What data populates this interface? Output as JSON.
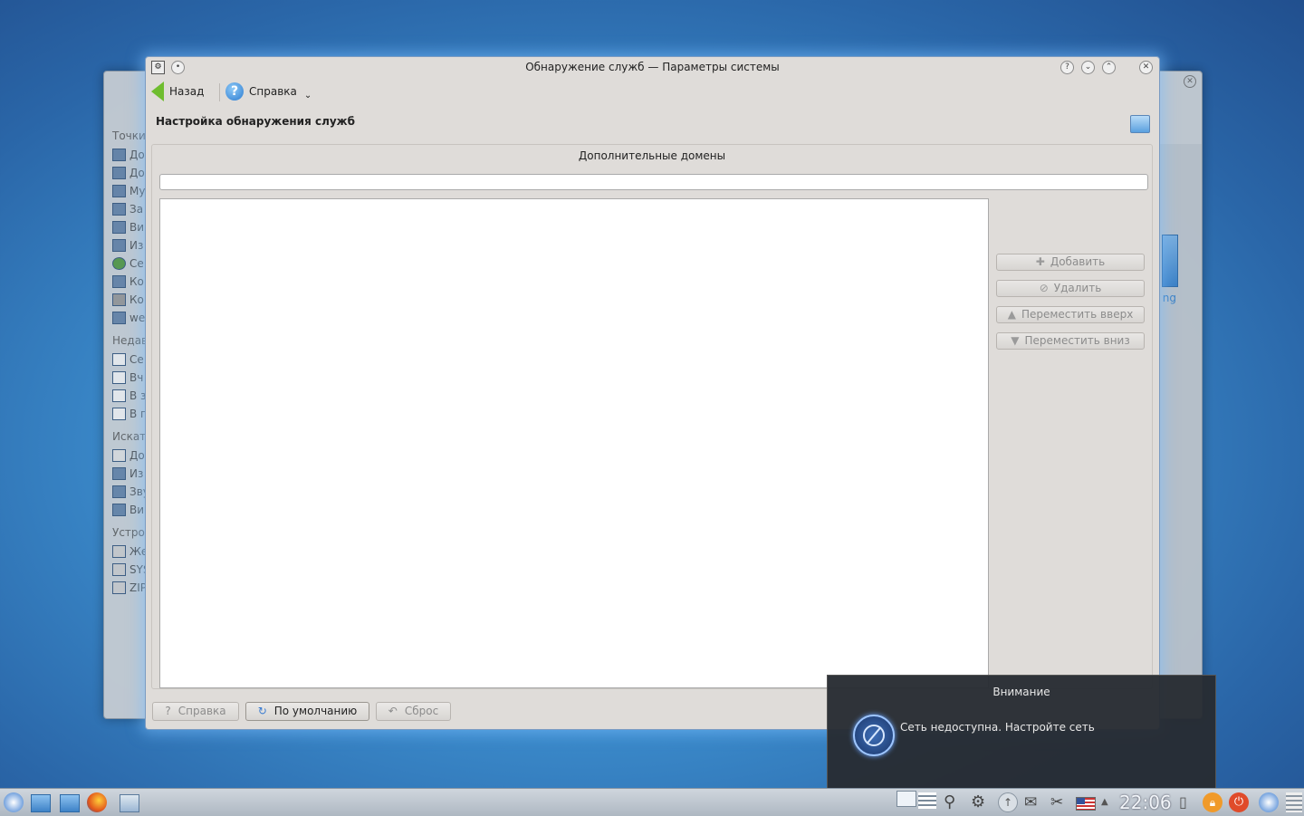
{
  "window": {
    "title": "Обнаружение служб — Параметры системы",
    "page_title": "Настройка обнаружения служб"
  },
  "toolbar": {
    "back_label": "Назад",
    "help_label": "Справка"
  },
  "domains": {
    "group_label": "Дополнительные домены",
    "input_value": "",
    "items": [],
    "buttons": {
      "add": "Добавить",
      "remove": "Удалить",
      "move_up": "Переместить вверх",
      "move_down": "Переместить вниз"
    }
  },
  "bottom": {
    "help": "Справка",
    "defaults": "По умолчанию",
    "reset": "Сброс"
  },
  "notification": {
    "title": "Внимание",
    "message": "Сеть недоступна. Настройте сеть"
  },
  "background_window": {
    "sections": [
      "Точки",
      "Недав",
      "Искат",
      "Устро"
    ],
    "places": [
      "До",
      "До",
      "Му",
      "За",
      "Ви",
      "Из",
      "Се",
      "Ко",
      "Ко",
      "we"
    ],
    "recent": [
      "Се",
      "Вч",
      "В з",
      "В п"
    ],
    "search": [
      "До",
      "Из",
      "Зву",
      "Ви"
    ],
    "devices": [
      "Же",
      "SYS",
      "ZIP"
    ],
    "right_label": "ng"
  },
  "taskbar": {
    "clock": "22:06"
  }
}
